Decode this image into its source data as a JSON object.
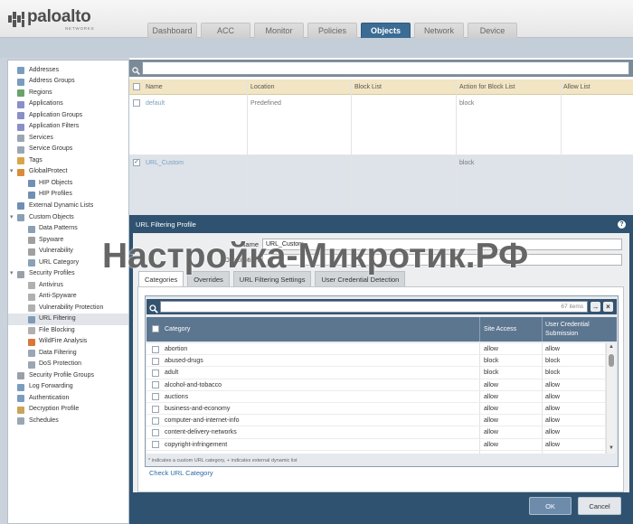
{
  "header": {
    "logo_main": "paloalto",
    "logo_sub": "NETWORKS",
    "logo_icon": "paloalto-logo-icon",
    "tabs": [
      "Dashboard",
      "ACC",
      "Monitor",
      "Policies",
      "Objects",
      "Network",
      "Device"
    ],
    "active_tab": "Objects"
  },
  "sidebar": {
    "selected": "URL Filtering",
    "items": [
      {
        "label": "Addresses",
        "icon": "address-icon",
        "level": 0
      },
      {
        "label": "Address Groups",
        "icon": "address-group-icon",
        "level": 0
      },
      {
        "label": "Regions",
        "icon": "region-icon",
        "level": 0
      },
      {
        "label": "Applications",
        "icon": "application-icon",
        "level": 0
      },
      {
        "label": "Application Groups",
        "icon": "application-group-icon",
        "level": 0
      },
      {
        "label": "Application Filters",
        "icon": "application-filter-icon",
        "level": 0
      },
      {
        "label": "Services",
        "icon": "service-icon",
        "level": 0
      },
      {
        "label": "Service Groups",
        "icon": "service-group-icon",
        "level": 0
      },
      {
        "label": "Tags",
        "icon": "tag-icon",
        "level": 0
      },
      {
        "label": "GlobalProtect",
        "icon": "globe-icon",
        "level": 0,
        "expanded": true
      },
      {
        "label": "HIP Objects",
        "icon": "hip-object-icon",
        "level": 1
      },
      {
        "label": "HIP Profiles",
        "icon": "hip-profile-icon",
        "level": 1
      },
      {
        "label": "External Dynamic Lists",
        "icon": "list-icon",
        "level": 0
      },
      {
        "label": "Custom Objects",
        "icon": "custom-objects-icon",
        "level": 0,
        "expanded": true
      },
      {
        "label": "Data Patterns",
        "icon": "data-pattern-icon",
        "level": 1
      },
      {
        "label": "Spyware",
        "icon": "spyware-icon",
        "level": 1
      },
      {
        "label": "Vulnerability",
        "icon": "vulnerability-icon",
        "level": 1
      },
      {
        "label": "URL Category",
        "icon": "url-category-icon",
        "level": 1
      },
      {
        "label": "Security Profiles",
        "icon": "security-profiles-icon",
        "level": 0,
        "expanded": true
      },
      {
        "label": "Antivirus",
        "icon": "antivirus-icon",
        "level": 1
      },
      {
        "label": "Anti-Spyware",
        "icon": "anti-spyware-icon",
        "level": 1
      },
      {
        "label": "Vulnerability Protection",
        "icon": "vulnerability-protection-icon",
        "level": 1
      },
      {
        "label": "URL Filtering",
        "icon": "url-filtering-icon",
        "level": 1
      },
      {
        "label": "File Blocking",
        "icon": "file-blocking-icon",
        "level": 1
      },
      {
        "label": "WildFire Analysis",
        "icon": "wildfire-icon",
        "level": 1
      },
      {
        "label": "Data Filtering",
        "icon": "data-filtering-icon",
        "level": 1
      },
      {
        "label": "DoS Protection",
        "icon": "dos-protection-icon",
        "level": 1
      },
      {
        "label": "Security Profile Groups",
        "icon": "profile-group-icon",
        "level": 0
      },
      {
        "label": "Log Forwarding",
        "icon": "log-forwarding-icon",
        "level": 0
      },
      {
        "label": "Authentication",
        "icon": "authentication-icon",
        "level": 0
      },
      {
        "label": "Decryption Profile",
        "icon": "decryption-icon",
        "level": 0
      },
      {
        "label": "Schedules",
        "icon": "schedule-icon",
        "level": 0
      }
    ]
  },
  "objects_table": {
    "search_icon": "search-icon",
    "columns": [
      "Name",
      "Location",
      "Block List",
      "Action for Block List",
      "Allow List"
    ],
    "rows": [
      {
        "name": "default",
        "location": "Predefined",
        "action": "block",
        "checked": false
      },
      {
        "name": "URL_Custom",
        "action": "block",
        "checked": true
      }
    ]
  },
  "dialog": {
    "title": "URL Filtering Profile",
    "help_icon": "help-icon",
    "name_label": "Name",
    "name_value": "URL_Custom",
    "description_label": "Description",
    "tabs": [
      "Categories",
      "Overrides",
      "URL Filtering Settings",
      "User Credential Detection"
    ],
    "active_tab": "Categories",
    "category_grid": {
      "items_count": "67 items",
      "columns": [
        "Category",
        "Site Access",
        "User Credential Submission"
      ],
      "rows": [
        {
          "category": "abortion",
          "site_access": "allow",
          "user_credential_submission": "allow"
        },
        {
          "category": "abused-drugs",
          "site_access": "block",
          "user_credential_submission": "block"
        },
        {
          "category": "adult",
          "site_access": "block",
          "user_credential_submission": "block"
        },
        {
          "category": "alcohol-and-tobacco",
          "site_access": "allow",
          "user_credential_submission": "allow"
        },
        {
          "category": "auctions",
          "site_access": "allow",
          "user_credential_submission": "allow"
        },
        {
          "category": "business-and-economy",
          "site_access": "allow",
          "user_credential_submission": "allow"
        },
        {
          "category": "computer-and-internet-info",
          "site_access": "allow",
          "user_credential_submission": "allow"
        },
        {
          "category": "content-delivery-networks",
          "site_access": "allow",
          "user_credential_submission": "allow"
        },
        {
          "category": "copyright-infringement",
          "site_access": "allow",
          "user_credential_submission": "allow"
        }
      ],
      "footnote": "* indicates a custom URL category, + indicates external dynamic list"
    },
    "check_link": "Check URL Category",
    "ok_label": "OK",
    "cancel_label": "Cancel"
  },
  "watermark": "Настройка-Микротик.РФ",
  "colors": {
    "active_tab": "#3b6c94",
    "dialog_frame": "#2f5270",
    "table_header": "#f2e5c3",
    "grid_header": "#5d7690",
    "link": "#2a6aa8"
  }
}
